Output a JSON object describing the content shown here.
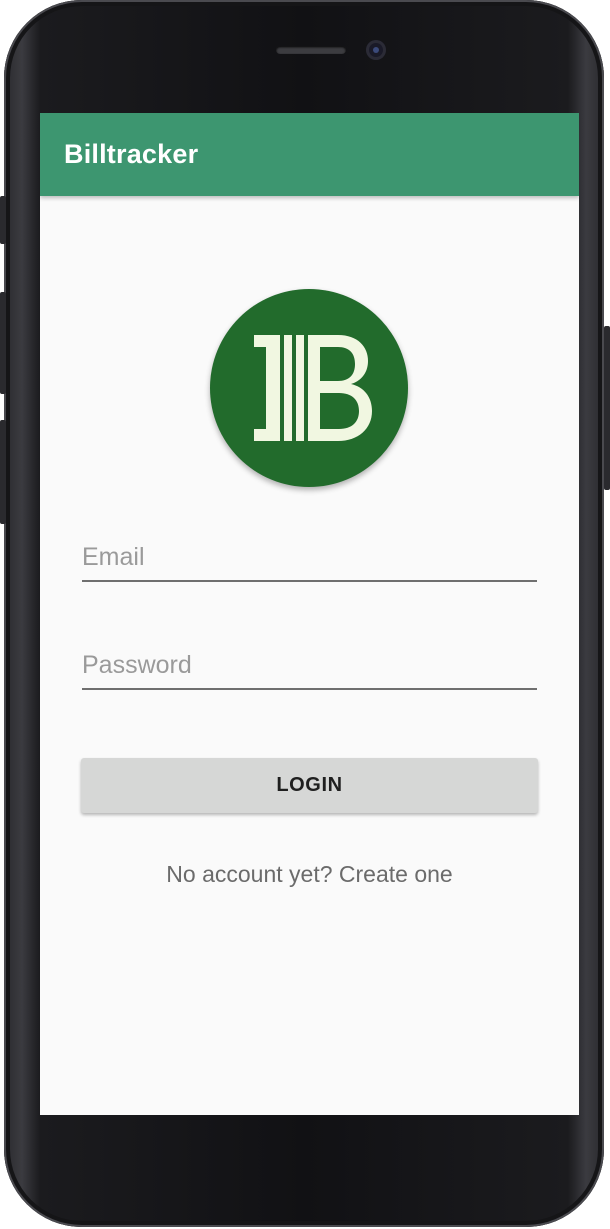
{
  "app_bar": {
    "title": "Billtracker"
  },
  "logo": {
    "icon": "billtracker-logo-icon",
    "background_color": "#226b2c",
    "glyph_color": "#f1f7e1"
  },
  "login_form": {
    "email_placeholder": "Email",
    "email_value": "",
    "password_placeholder": "Password",
    "password_value": "",
    "login_label": "LOGIN",
    "signup_link": "No account yet? Create one"
  },
  "colors": {
    "primary": "#3d9670",
    "background": "#fafafa",
    "button": "#d6d7d6"
  }
}
